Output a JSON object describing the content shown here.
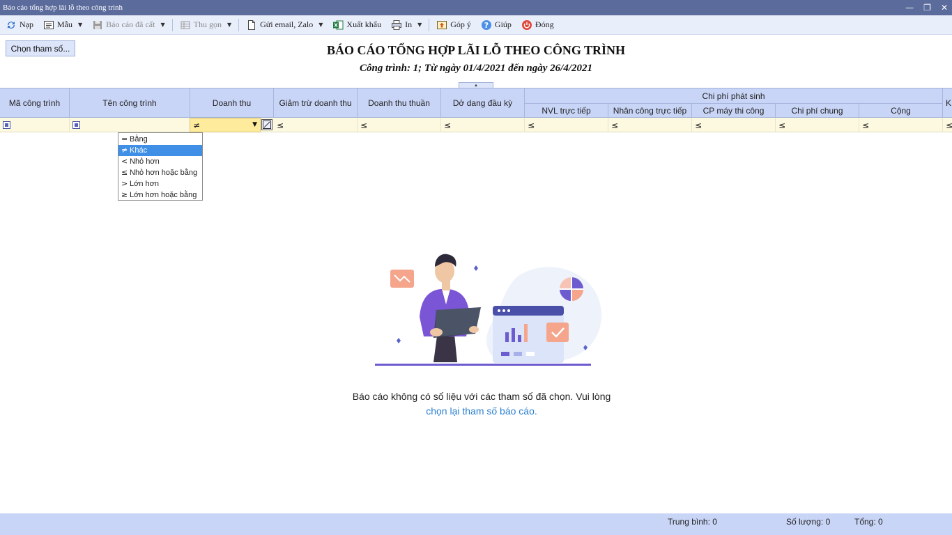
{
  "window": {
    "title": "Báo cáo tổng hợp lãi lỗ theo công trình"
  },
  "toolbar": {
    "reload": "Nạp",
    "template": "Mẫu",
    "saved_report": "Báo cáo đã cất",
    "collapse": "Thu gọn",
    "send": "Gửi email, Zalo",
    "export": "Xuất khẩu",
    "print": "In",
    "feedback": "Góp ý",
    "help": "Giúp",
    "close": "Đóng"
  },
  "params_button": "Chọn tham số...",
  "report": {
    "title": "BÁO CÁO TỔNG HỢP LÃI LỖ THEO CÔNG TRÌNH",
    "subtitle": "Công trình: 1; Từ ngày 01/4/2021 đến ngày 26/4/2021"
  },
  "columns": {
    "code": "Mã công trình",
    "name": "Tên công trình",
    "revenue": "Doanh thu",
    "revenue_deduction": "Giảm trừ doanh thu",
    "net_revenue": "Doanh thu thuần",
    "opening_wip": "Dở dang đầu kỳ",
    "costs_group": "Chi phí phát sinh",
    "direct_material": "NVL trực tiếp",
    "direct_labor": "Nhân công trực tiếp",
    "machine_cost": "CP máy thi công",
    "overhead": "Chi phí chung",
    "total": "Cộng",
    "next_partial": "K"
  },
  "filters": {
    "revenue_selected": "≠",
    "default_op": "≤"
  },
  "operator_dropdown": [
    {
      "symbol": "=",
      "label": "Bằng",
      "selected": false
    },
    {
      "symbol": "≠",
      "label": "Khác",
      "selected": true
    },
    {
      "symbol": "<",
      "label": "Nhỏ hơn",
      "selected": false
    },
    {
      "symbol": "≤",
      "label": "Nhỏ hơn hoặc bằng",
      "selected": false
    },
    {
      "symbol": ">",
      "label": "Lớn hơn",
      "selected": false
    },
    {
      "symbol": "≥",
      "label": "Lớn hơn hoặc bằng",
      "selected": false
    }
  ],
  "empty_state": {
    "line1": "Báo cáo không có số liệu với các tham số đã chọn. Vui lòng",
    "link": "chọn lại tham số báo cáo."
  },
  "status": {
    "average": "Trung bình: 0",
    "count": "Số lượng: 0",
    "sum": "Tổng: 0"
  },
  "colors": {
    "titlebar": "#5b6b9c",
    "header": "#c9d5f7",
    "filter_row": "#fdf9e0",
    "dropdown_active": "#3f8fe6",
    "link": "#2a7fd0"
  }
}
